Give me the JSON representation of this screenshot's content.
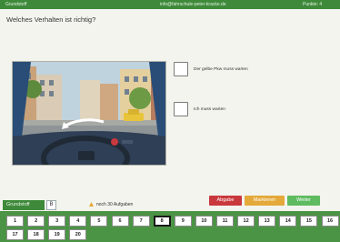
{
  "topbar": {
    "title": "Grundstoff",
    "email": "info@fahrschule-peter-kracke.de",
    "points": "Punkte: 4"
  },
  "question": {
    "text": "Welches Verhalten ist richtig?"
  },
  "answers": [
    {
      "label": "Der gelbe Pkw muss warten"
    },
    {
      "label": "Ich muss warten"
    }
  ],
  "footer": {
    "tab_basis": "Grundstoff",
    "tab_b": "B",
    "remaining": "noch 30 Aufgaben",
    "btn_abgabe": "Abgabe",
    "btn_markieren": "Markieren",
    "btn_weiter": "Weiter"
  },
  "nav": {
    "questions": [
      "1",
      "2",
      "3",
      "4",
      "5",
      "6",
      "7",
      "8",
      "9",
      "10",
      "11",
      "12",
      "13",
      "14",
      "15",
      "16",
      "17",
      "18",
      "19",
      "20"
    ],
    "active_index": 7
  },
  "colors": {
    "brand_green": "#3e8a3a",
    "nav_green": "#4c9445",
    "abgabe_red": "#c9383c",
    "markieren_orange": "#e4a93a",
    "weiter_green": "#5fbb60"
  }
}
